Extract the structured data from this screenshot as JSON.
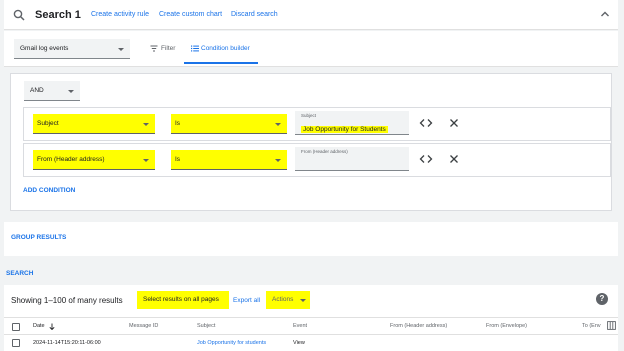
{
  "header": {
    "title": "Search 1",
    "links": [
      "Create activity rule",
      "Create custom chart",
      "Discard search"
    ]
  },
  "source": {
    "selected": "Gmail log events",
    "tabs": [
      "Filter",
      "Condition builder"
    ],
    "active_tab": "Condition builder"
  },
  "builder": {
    "operator": "AND",
    "conditions": [
      {
        "field": "Subject",
        "op": "Is",
        "value_label": "Subject",
        "value": "Job Opportunity for Students"
      },
      {
        "field": "From (Header address)",
        "op": "Is",
        "value_label": "From (Header address)",
        "value": ""
      }
    ],
    "add_label": "ADD CONDITION"
  },
  "group_results_label": "GROUP RESULTS",
  "search_label": "SEARCH",
  "results": {
    "showing": "Showing 1–100 of many results",
    "select_all": "Select results on all pages",
    "export": "Export all",
    "actions": "Actions",
    "help": "?",
    "columns": [
      "Date",
      "Message ID",
      "Subject",
      "Event",
      "From (Header address)",
      "From (Envelope)",
      "To (Env"
    ],
    "rows": [
      {
        "date": "2024-11-14T15:20:11-06:00",
        "message_id": "",
        "subject": "Job Opportunity for students",
        "event": "View"
      }
    ]
  },
  "colors": {
    "accent": "#1a73e8",
    "highlight": "#ffff00"
  },
  "icons": [
    "search-icon",
    "collapse-icon",
    "filter-icon",
    "list-icon",
    "code-icon",
    "close-icon",
    "sort-down-icon",
    "help-icon",
    "columns-icon"
  ]
}
